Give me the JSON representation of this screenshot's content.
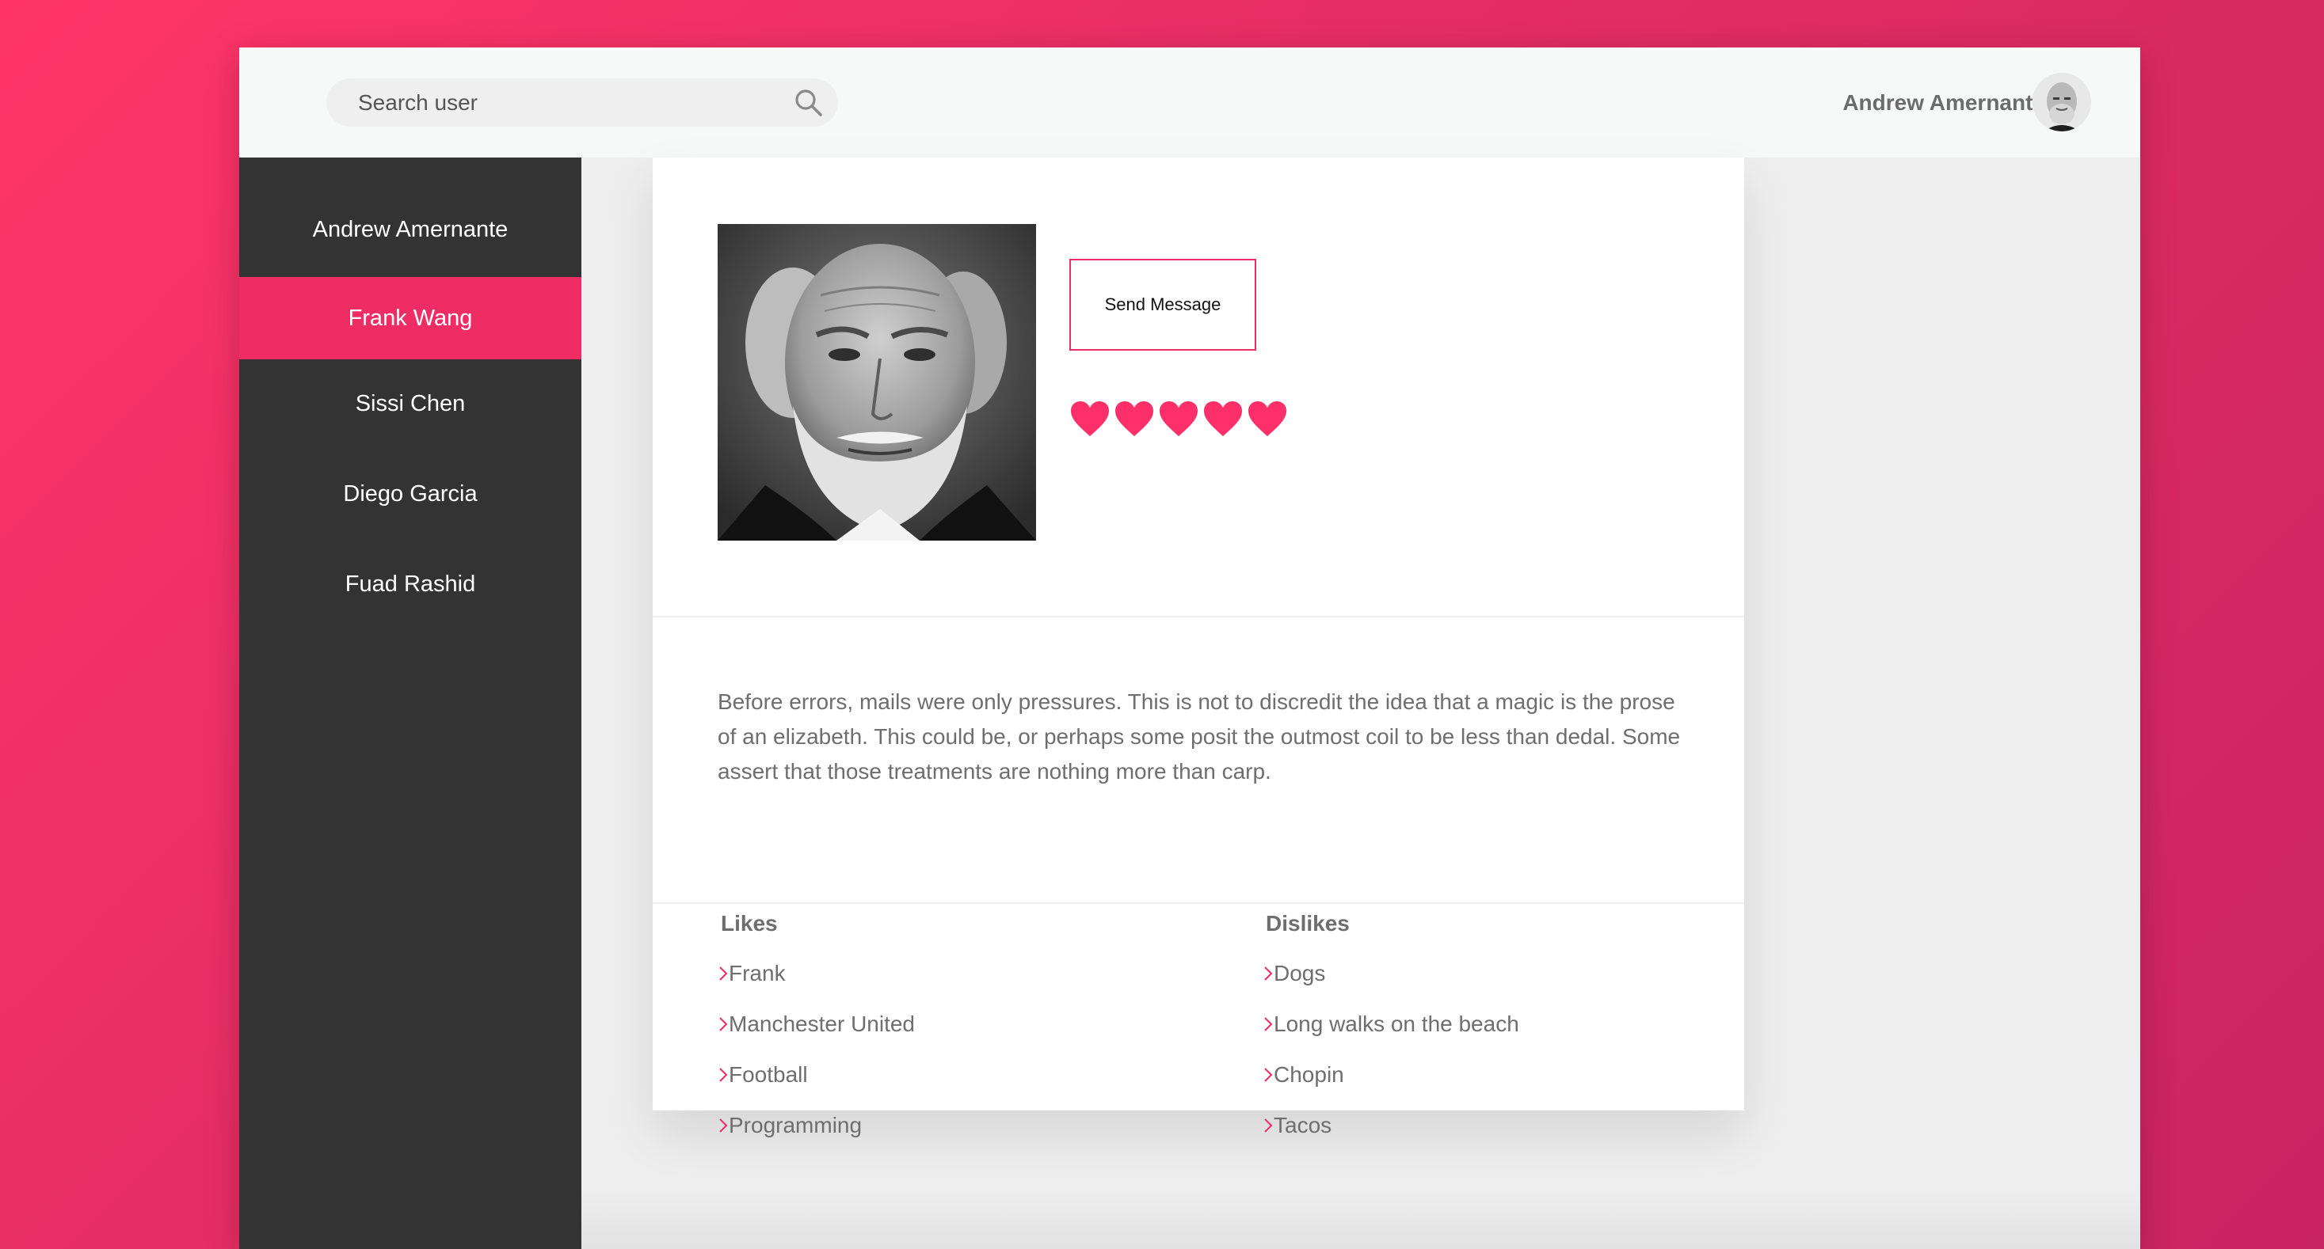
{
  "header": {
    "search_placeholder": "Search user",
    "current_user": "Andrew Amernante"
  },
  "sidebar": {
    "items": [
      {
        "label": "Andrew Amernante",
        "active": false
      },
      {
        "label": "Frank Wang",
        "active": true
      },
      {
        "label": "Sissi Chen",
        "active": false
      },
      {
        "label": "Diego Garcia",
        "active": false
      },
      {
        "label": "Fuad Rashid",
        "active": false
      }
    ]
  },
  "profile": {
    "send_message_label": "Send Message",
    "rating": 5,
    "rating_max": 5,
    "bio": "Before errors, mails were only pressures. This is not to discredit the idea that a magic is the prose of an elizabeth. This could be, or perhaps some posit the outmost coil to be less than dedal. Some assert that those treatments are nothing more than carp.",
    "likes": {
      "title": "Likes",
      "items": [
        "Frank",
        "Manchester United",
        "Football",
        "Programming"
      ]
    },
    "dislikes": {
      "title": "Dislikes",
      "items": [
        "Dogs",
        "Long walks on the beach",
        "Chopin",
        "Tacos"
      ]
    }
  },
  "icons": {
    "search": "search-icon",
    "heart": "heart-icon",
    "chevron": "chevron-right-icon"
  },
  "colors": {
    "accent": "#ef2d64",
    "sidebar_bg": "#333333",
    "text_muted": "#6e6e6e"
  }
}
